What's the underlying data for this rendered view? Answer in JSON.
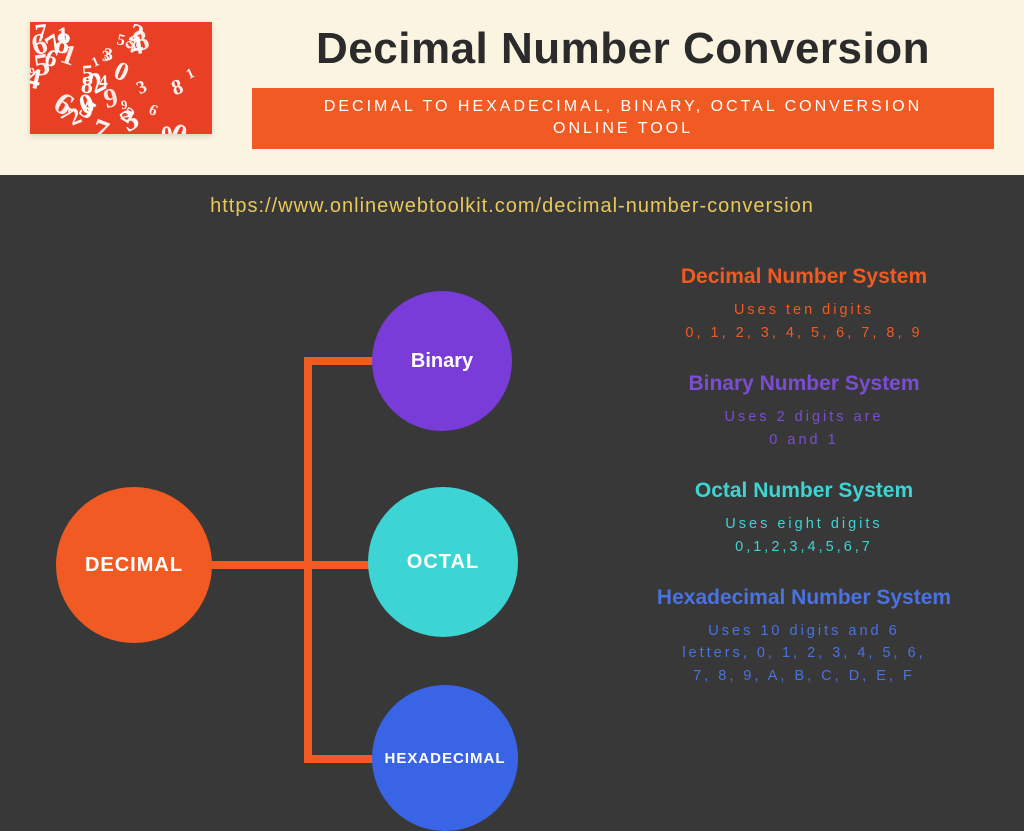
{
  "header": {
    "title": "Decimal Number Conversion",
    "subtitle_line1": "DECIMAL TO HEXADECIMAL, BINARY, OCTAL CONVERSION",
    "subtitle_line2": "ONLINE TOOL"
  },
  "url": "https://www.onlinewebtoolkit.com/decimal-number-conversion",
  "nodes": {
    "root": "DECIMAL",
    "binary": "Binary",
    "octal": "OCTAL",
    "hex": "HEXADECIMAL"
  },
  "info": {
    "decimal": {
      "title": "Decimal Number System",
      "line1": "Uses ten digits",
      "line2": "0, 1, 2, 3, 4, 5, 6, 7, 8, 9"
    },
    "binary": {
      "title": "Binary Number System",
      "line1": "Uses 2 digits are",
      "line2": "0 and 1"
    },
    "octal": {
      "title": "Octal Number System",
      "line1": "Uses eight digits",
      "line2": "0,1,2,3,4,5,6,7"
    },
    "hex": {
      "title": "Hexadecimal Number System",
      "line1": "Uses 10 digits and 6",
      "line2": "letters, 0, 1, 2, 3, 4, 5, 6,",
      "line3": "7, 8, 9, A, B, C, D, E, F"
    }
  },
  "logo_digits": [
    "0",
    "2",
    "5",
    "8",
    "3",
    "9",
    "1",
    "4",
    "6",
    "7",
    "2",
    "8",
    "0",
    "3",
    "9",
    "5",
    "1",
    "4",
    "6",
    "7",
    "2",
    "8",
    "3",
    "0",
    "9",
    "5",
    "1",
    "4",
    "6",
    "2",
    "8",
    "3",
    "7",
    "0",
    "9",
    "5",
    "1",
    "4",
    "6",
    "7"
  ]
}
